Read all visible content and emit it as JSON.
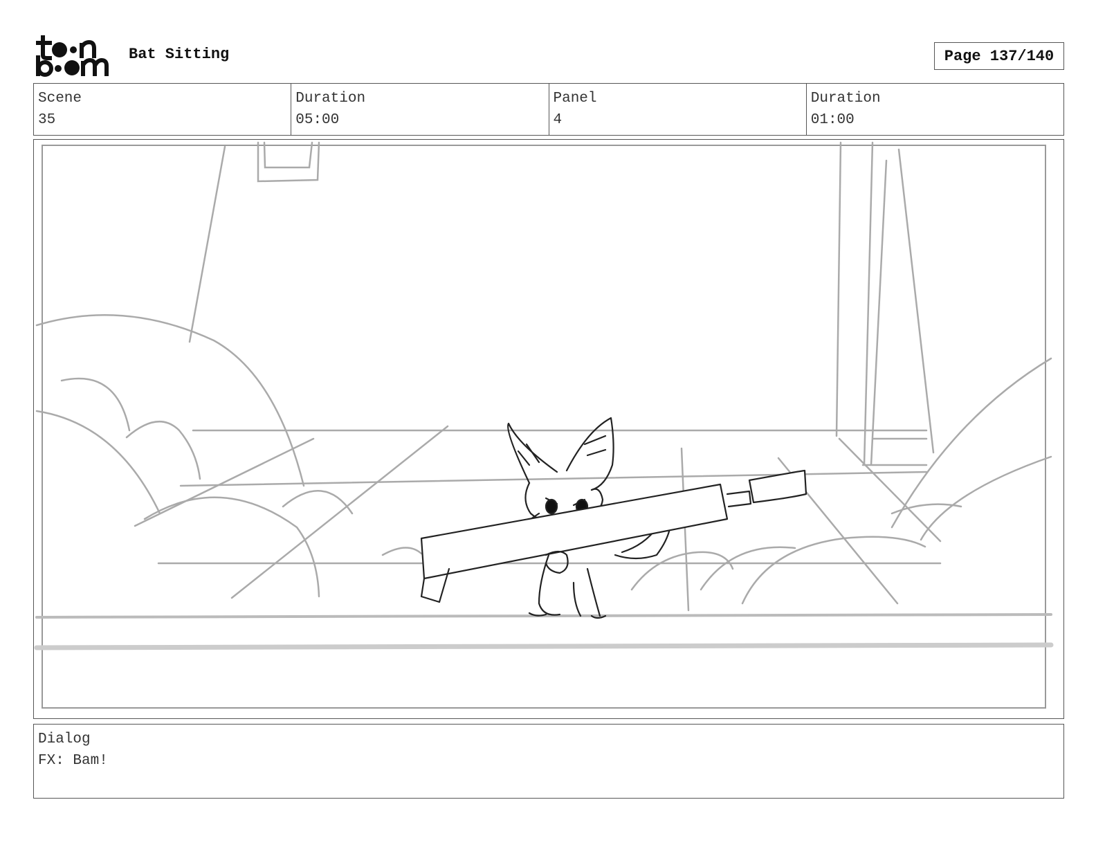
{
  "header": {
    "logo_text": "toonboom",
    "project_title": "Bat Sitting",
    "page_indicator": "Page 137/140"
  },
  "info": {
    "scene_label": "Scene",
    "scene_value": "35",
    "scene_duration_label": "Duration",
    "scene_duration_value": "05:00",
    "panel_label": "Panel",
    "panel_value": "4",
    "panel_duration_label": "Duration",
    "panel_duration_value": "01:00"
  },
  "panel": {
    "image_description": "storyboard sketch"
  },
  "dialog": {
    "label": "Dialog",
    "text": "FX: Bam!"
  }
}
